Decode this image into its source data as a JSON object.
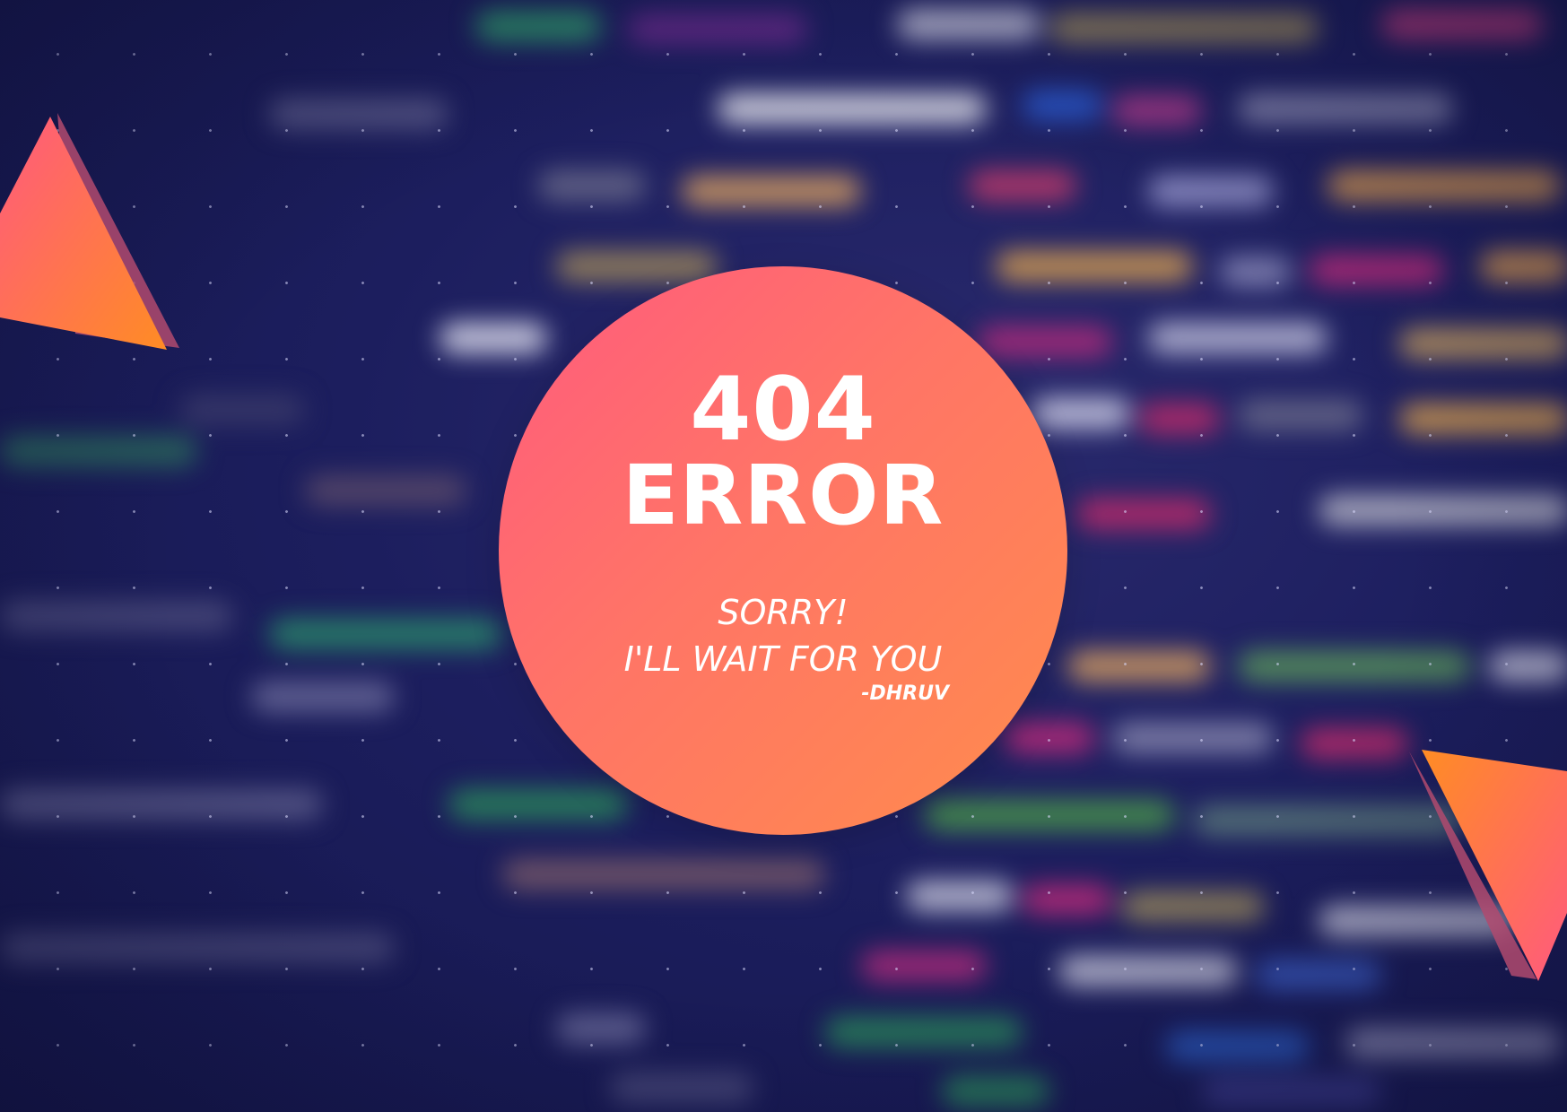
{
  "error": {
    "code": "404",
    "word": "ERROR",
    "message_line_1": "SORRY!",
    "message_line_2": "I'LL WAIT FOR YOU",
    "signature": "-DHRUV"
  },
  "colors": {
    "background": "#1b1d5c",
    "circle_start": "#ff5a7e",
    "circle_end": "#ff8c4c",
    "text": "#ffffff"
  },
  "decorations": [
    "triangle-icon",
    "triangle-icon"
  ]
}
